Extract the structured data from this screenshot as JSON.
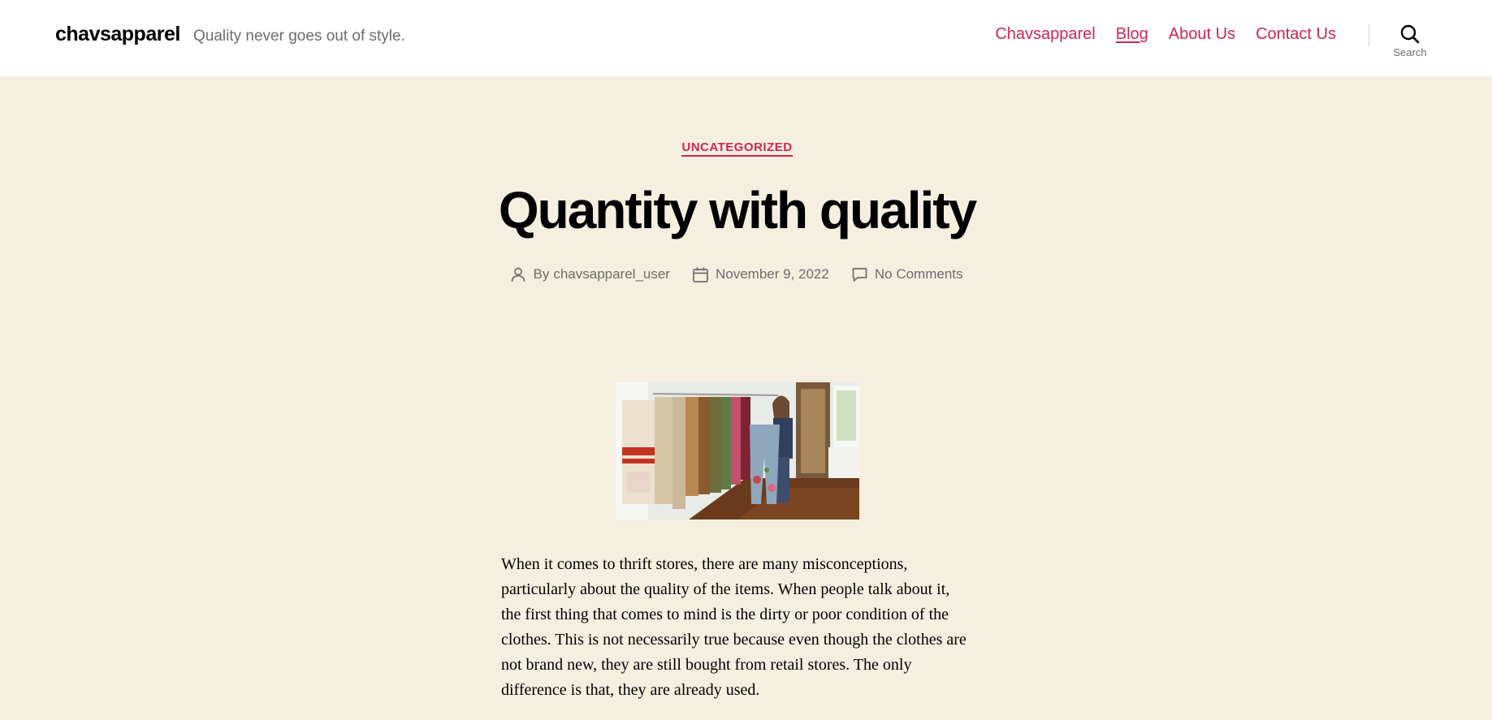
{
  "header": {
    "site_title": "chavsapparel",
    "tagline": "Quality never goes out of style.",
    "nav": [
      {
        "label": "Chavsapparel"
      },
      {
        "label": "Blog"
      },
      {
        "label": "About Us"
      },
      {
        "label": "Contact Us"
      }
    ],
    "search_label": "Search",
    "search_icon": "search-icon"
  },
  "post": {
    "category": "UNCATEGORIZED",
    "title": "Quantity with quality",
    "author_prefix": "By",
    "author": "chavsapparel_user",
    "date": "November 9, 2022",
    "comments": "No Comments",
    "featured_image": "photo of a woman holding up embroidered jeans next to a rack of colourful vintage clothes",
    "paragraph": "When it comes to thrift stores, there are many misconceptions, particularly about the quality of the items. When people talk about it, the first thing that comes to mind is the dirty or poor condition of the clothes. This is not necessarily true because even though the clothes are not brand new, they are still bought from retail stores. The only difference is that, they are already used."
  },
  "colors": {
    "accent": "#cd2653",
    "background": "#f5efe0",
    "header_background": "#ffffff",
    "muted_text": "#6d6d6d"
  }
}
